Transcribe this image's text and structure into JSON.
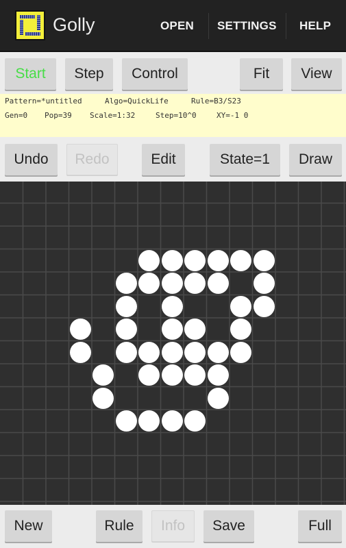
{
  "app": {
    "title": "Golly",
    "logo_icon": "golly-logo-icon",
    "menu": [
      {
        "label": "OPEN"
      },
      {
        "label": "SETTINGS"
      },
      {
        "label": "HELP"
      }
    ]
  },
  "toolbar_top": {
    "start": "Start",
    "step": "Step",
    "control": "Control",
    "fit": "Fit",
    "view": "View"
  },
  "status": {
    "pattern": "Pattern=*untitled",
    "algo": "Algo=QuickLife",
    "rule": "Rule=B3/S23",
    "gen": "Gen=0",
    "pop": "Pop=39",
    "scale": "Scale=1:32",
    "step": "Step=10^0",
    "xy": "XY=-1 0"
  },
  "toolbar_edit": {
    "undo": "Undo",
    "redo": "Redo",
    "edit": "Edit",
    "state": "State=1",
    "draw": "Draw"
  },
  "toolbar_bottom": {
    "new": "New",
    "rule": "Rule",
    "info": "Info",
    "save": "Save",
    "full": "Full"
  },
  "colors": {
    "start_accent": "#47dd47",
    "cell_live": "#ffffff",
    "grid_background": "#2f2f2f",
    "grid_line": "#4a4a4a",
    "info_panel": "#fffdcc"
  },
  "pattern": {
    "population": 39,
    "live_cells": [
      [
        3,
        6
      ],
      [
        3,
        7
      ],
      [
        3,
        8
      ],
      [
        3,
        9
      ],
      [
        3,
        10
      ],
      [
        3,
        11
      ],
      [
        4,
        5
      ],
      [
        4,
        6
      ],
      [
        4,
        7
      ],
      [
        4,
        8
      ],
      [
        4,
        9
      ],
      [
        4,
        11
      ],
      [
        5,
        5
      ],
      [
        5,
        7
      ],
      [
        5,
        10
      ],
      [
        5,
        11
      ],
      [
        6,
        3
      ],
      [
        6,
        5
      ],
      [
        6,
        7
      ],
      [
        6,
        8
      ],
      [
        6,
        10
      ],
      [
        7,
        3
      ],
      [
        7,
        5
      ],
      [
        7,
        6
      ],
      [
        7,
        7
      ],
      [
        7,
        8
      ],
      [
        7,
        9
      ],
      [
        7,
        10
      ],
      [
        8,
        4
      ],
      [
        8,
        6
      ],
      [
        8,
        7
      ],
      [
        8,
        8
      ],
      [
        8,
        9
      ],
      [
        9,
        4
      ],
      [
        9,
        9
      ],
      [
        10,
        5
      ],
      [
        10,
        6
      ],
      [
        10,
        7
      ],
      [
        10,
        8
      ]
    ]
  }
}
